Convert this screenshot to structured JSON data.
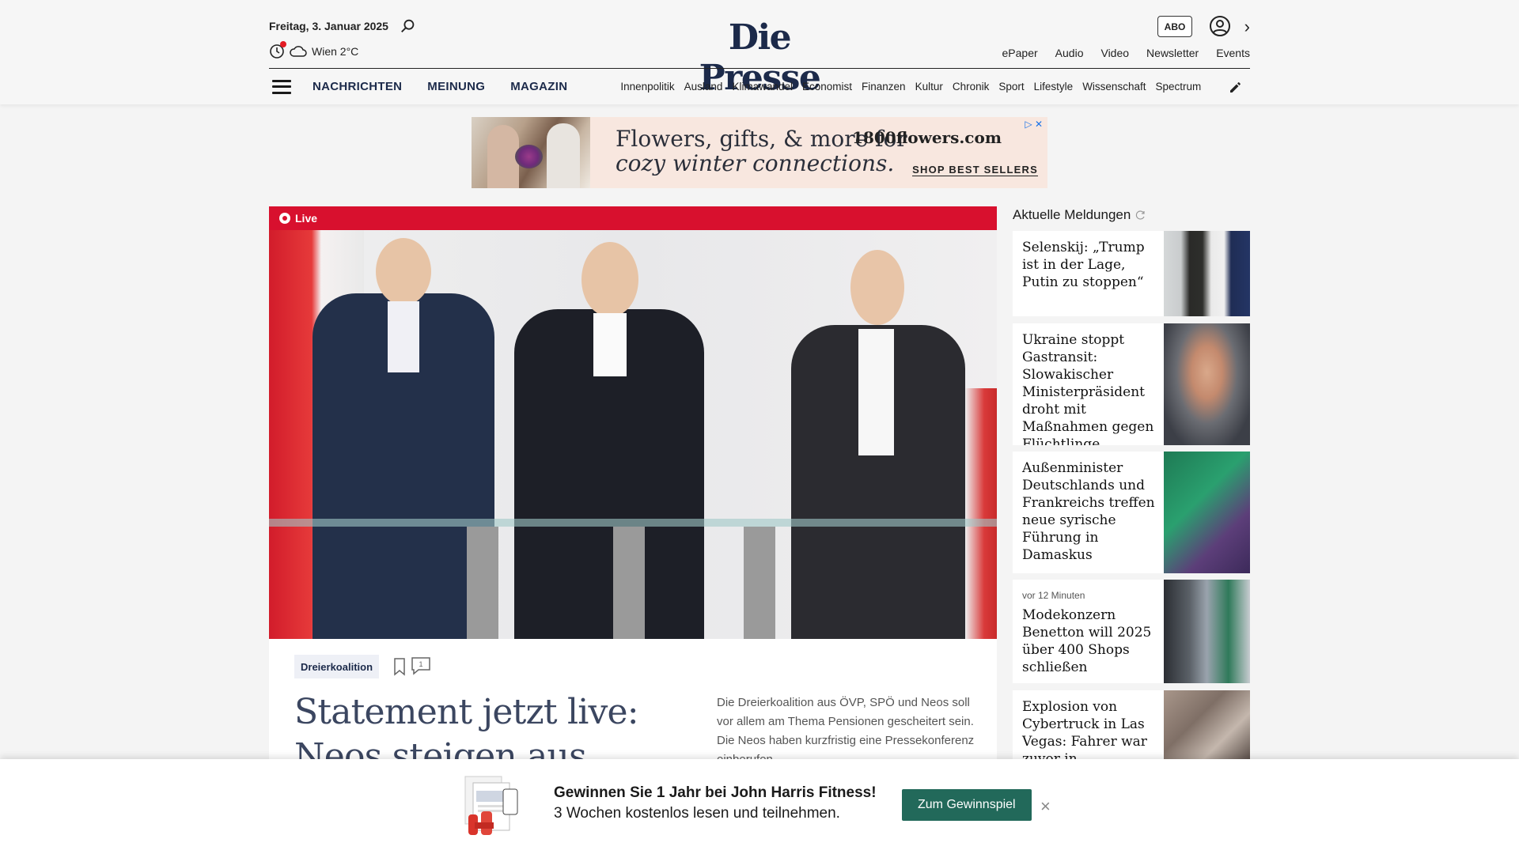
{
  "header": {
    "date": "Freitag, 3. Januar 2025",
    "weather": "Wien 2°C",
    "logo": "Die Presse",
    "abo_label": "ABO",
    "top_links": [
      "ePaper",
      "Audio",
      "Video",
      "Newsletter",
      "Events"
    ],
    "main_nav": [
      "NACHRICHTEN",
      "MEINUNG",
      "MAGAZIN"
    ],
    "sub_nav": [
      "Innenpolitik",
      "Ausland",
      "Klimawandel",
      "Economist",
      "Finanzen",
      "Kultur",
      "Chronik",
      "Sport",
      "Lifestyle",
      "Wissenschaft",
      "Spectrum"
    ]
  },
  "ad": {
    "line1": "Flowers, gifts, & more for",
    "line2": "cozy winter connections.",
    "brand": "1800flowers.com",
    "cta": "SHOP BEST SELLERS"
  },
  "main": {
    "live_label": "Live",
    "tag": "Dreierkoalition",
    "comment_count": "1",
    "headline": "Statement jetzt live: Neos steigen aus Koalitionsverhandlungen aus",
    "teaser": "Die Dreierkoalition aus ÖVP, SPÖ und Neos soll vor allem am Thema Pensionen gescheitert sein. Die Neos haben kurzfristig eine Pressekonferenz einberufen."
  },
  "sidebar": {
    "title": "Aktuelle Meldungen",
    "items": [
      {
        "meta": "",
        "text": "Selenskij: „Trump ist in der Lage, Putin zu stoppen“"
      },
      {
        "meta": "",
        "text": "Ukraine stoppt Gastransit: Slowakischer Minis­terpräsident droht mit Maßnahmen gegen Flüchtlinge"
      },
      {
        "meta": "",
        "text": "Außenminister Deutschlands und Frankreichs treffen neue syrische Führung in Damaskus"
      },
      {
        "meta": "vor 12 Minuten",
        "text": "Modekonzern Benetton will 2025 über 400 Shops schließen"
      },
      {
        "meta": "",
        "text": "Explosion von Cybertruck in Las Vegas: Fahrer war zuvor in Deutschland"
      }
    ]
  },
  "banner": {
    "title": "Gewinnen Sie 1 Jahr bei John Harris Fitness!",
    "subtitle": "3 Wochen kostenlos lesen und teilnehmen.",
    "button": "Zum Gewinnspiel",
    "close": "×"
  },
  "colors": {
    "brand_navy": "#1c2a4a",
    "live_red": "#d8102e",
    "cta_green": "#22695a"
  }
}
